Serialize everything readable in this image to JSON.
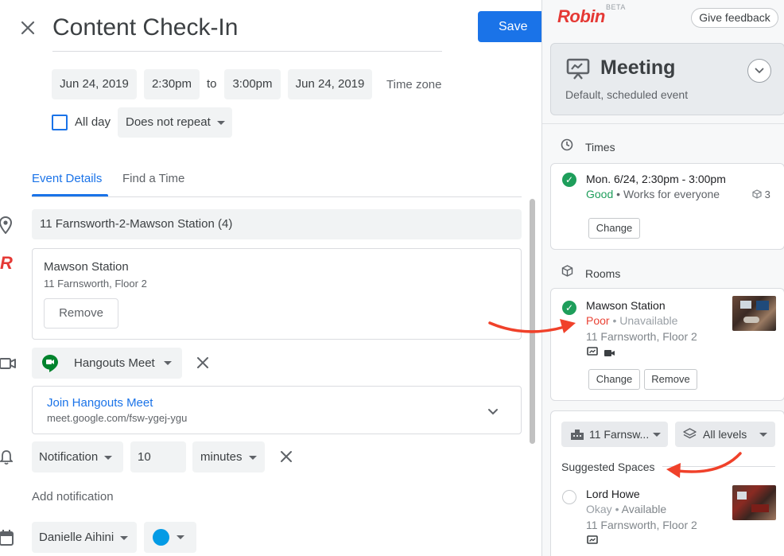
{
  "event": {
    "title": "Content Check-In",
    "save_label": "Save",
    "start_date": "Jun 24, 2019",
    "start_time": "2:30pm",
    "to_label": "to",
    "end_time": "3:00pm",
    "end_date": "Jun 24, 2019",
    "timezone_label": "Time zone",
    "allday_label": "All day",
    "repeat_value": "Does not repeat"
  },
  "tabs": [
    {
      "label": "Event Details"
    },
    {
      "label": "Find a Time"
    }
  ],
  "details": {
    "location_value": "11 Farnsworth-2-Mawson Station (4)",
    "room_card": {
      "name": "Mawson Station",
      "address": "11 Farnsworth, Floor 2",
      "remove_label": "Remove"
    },
    "conference": {
      "selected": "Hangouts Meet",
      "join_label": "Join Hangouts Meet",
      "join_url": "meet.google.com/fsw-ygej-ygu"
    },
    "notification": {
      "type": "Notification",
      "amount": "10",
      "unit": "minutes",
      "add_label": "Add notification"
    },
    "calendar": {
      "owner": "Danielle Aihini",
      "color": "#039be5"
    }
  },
  "robin": {
    "logo": "Robin",
    "beta": "BETA",
    "feedback_label": "Give feedback",
    "event_type": {
      "title": "Meeting",
      "subtitle": "Default, scheduled event"
    },
    "times": {
      "header": "Times",
      "time_text": "Mon. 6/24, 2:30pm - 3:00pm",
      "status": "Good",
      "status_color": "#1e9e5b",
      "detail": "Works for everyone",
      "count": "3",
      "change_label": "Change"
    },
    "rooms": {
      "header": "Rooms",
      "name": "Mawson Station",
      "status": "Poor",
      "status_color": "#ea4335",
      "detail": "Unavailable",
      "address": "11 Farnsworth, Floor 2",
      "change_label": "Change",
      "remove_label": "Remove"
    },
    "filters": {
      "building": "11 Farnsw...",
      "levels": "All levels"
    },
    "suggested": {
      "header": "Suggested Spaces",
      "items": [
        {
          "name": "Lord Howe",
          "status": "Okay",
          "detail": "Available",
          "address": "11 Farnsworth, Floor 2"
        }
      ]
    }
  },
  "colors": {
    "primary": "#1a73e8",
    "robin_red": "#e53935",
    "arrow_red": "#f0412a"
  }
}
